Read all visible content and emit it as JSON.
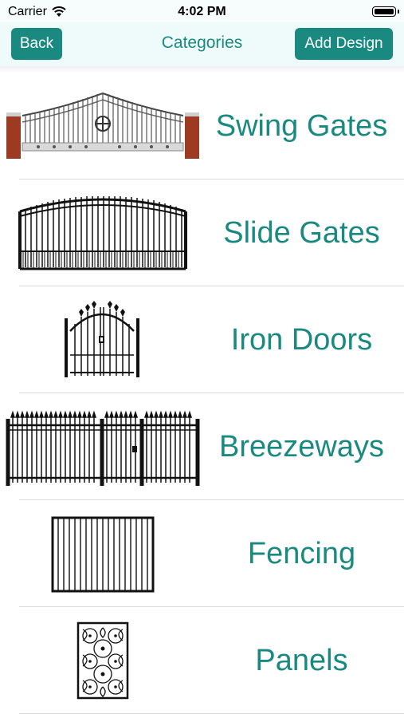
{
  "status_bar": {
    "carrier": "Carrier",
    "time": "4:02 PM"
  },
  "nav": {
    "back_label": "Back",
    "title": "Categories",
    "add_label": "Add Design"
  },
  "categories": [
    {
      "label": "Swing Gates"
    },
    {
      "label": "Slide Gates"
    },
    {
      "label": "Iron Doors"
    },
    {
      "label": "Breezeways"
    },
    {
      "label": "Fencing"
    },
    {
      "label": "Panels"
    }
  ],
  "colors": {
    "accent": "#1a8a80",
    "nav_background": "#eefbfa"
  }
}
